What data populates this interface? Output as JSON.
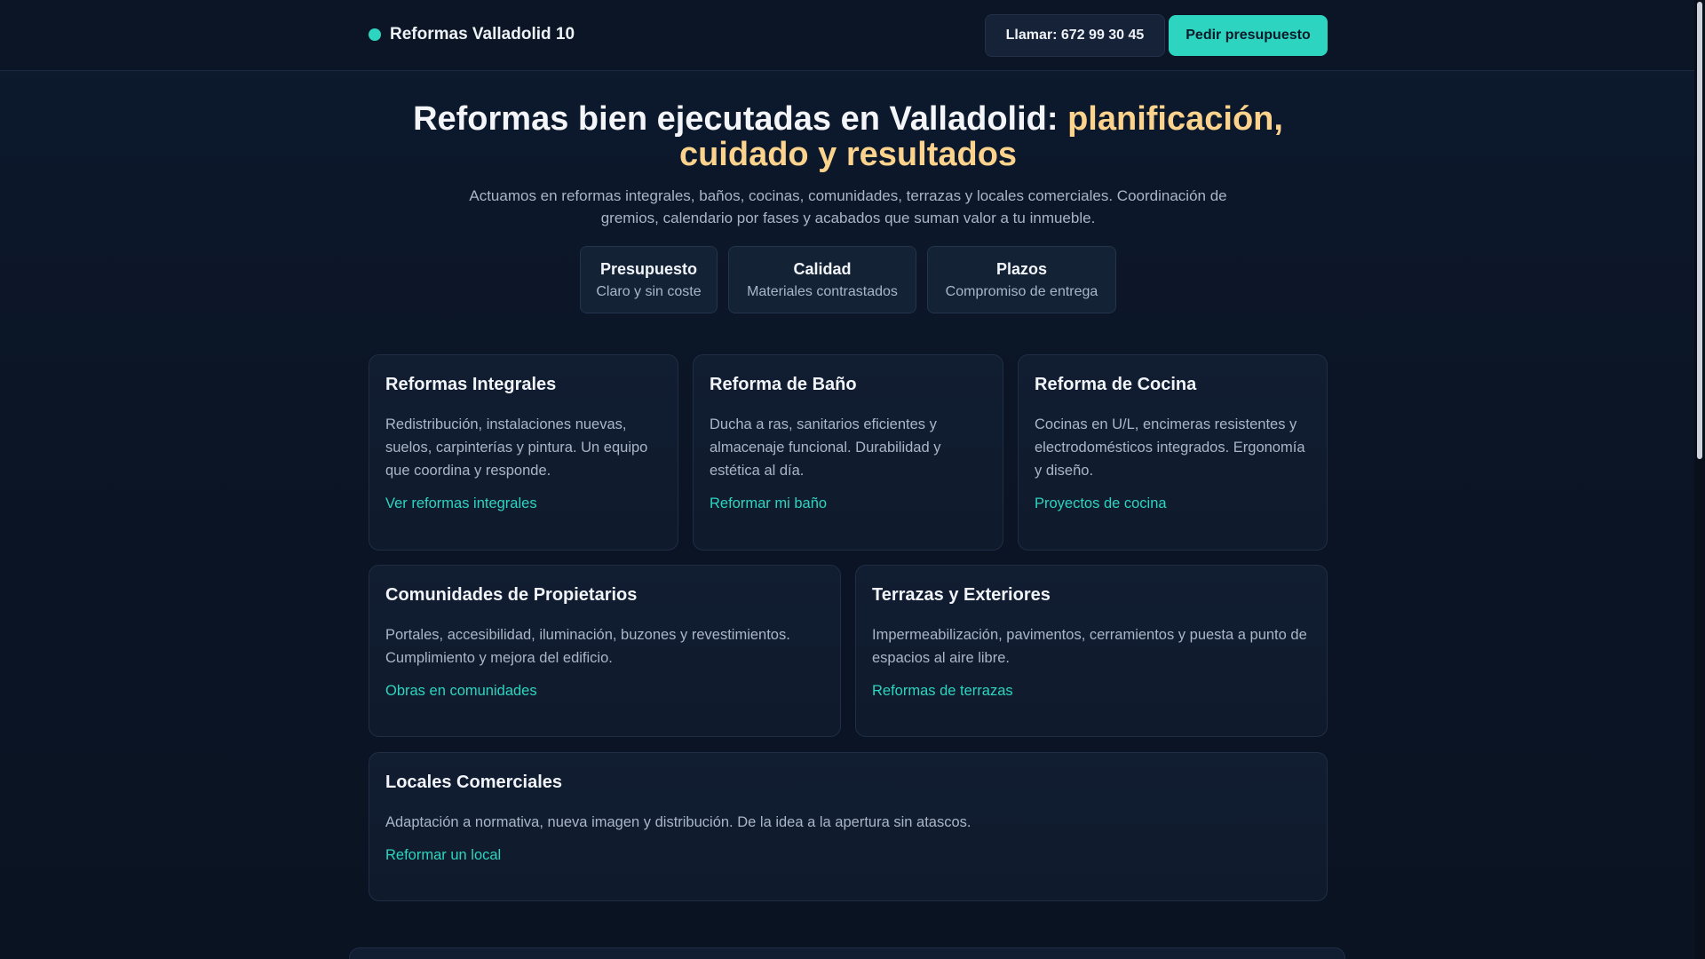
{
  "header": {
    "brand": "Reformas Valladolid 10",
    "call_label": "Llamar: 672 99 30 45",
    "quote_label": "Pedir presupuesto"
  },
  "hero": {
    "title_part1": "Reformas bien ejecutadas en Valladolid: ",
    "title_part2": "planificación, cuidado y resultados",
    "subtitle": "Actuamos en reformas integrales, baños, cocinas, comunidades, terrazas y locales comerciales. Coordinación de gremios, calendario por fases y acabados que suman valor a tu inmueble."
  },
  "features": [
    {
      "title": "Presupuesto",
      "text": "Claro y sin coste"
    },
    {
      "title": "Calidad",
      "text": "Materiales contrastados"
    },
    {
      "title": "Plazos",
      "text": "Compromiso de entrega"
    }
  ],
  "services": [
    {
      "title": "Reformas Integrales",
      "text": "Redistribución, instalaciones nuevas, suelos, carpinterías y pintura. Un equipo que coordina y responde.",
      "link": "Ver reformas integrales"
    },
    {
      "title": "Reforma de Baño",
      "text": "Ducha a ras, sanitarios eficientes y almacenaje funcional. Durabilidad y estética al día.",
      "link": "Reformar mi baño"
    },
    {
      "title": "Reforma de Cocina",
      "text": "Cocinas en U/L, encimeras resistentes y electrodomésticos integrados. Ergonomía y diseño.",
      "link": "Proyectos de cocina"
    },
    {
      "title": "Comunidades de Propietarios",
      "text": "Portales, accesibilidad, iluminación, buzones y revestimientos. Cumplimiento y mejora del edificio.",
      "link": "Obras en comunidades"
    },
    {
      "title": "Terrazas y Exteriores",
      "text": "Impermeabilización, pavimentos, cerramientos y puesta a punto de espacios al aire libre.",
      "link": "Reformas de terrazas"
    },
    {
      "title": "Locales Comerciales",
      "text": "Adaptación a normativa, nueva imagen y distribución. De la idea a la apertura sin atascos.",
      "link": "Reformar un local"
    }
  ],
  "colors": {
    "accent": "#2dd4bf",
    "highlight": "#fbd38d",
    "background": "#0b1424"
  }
}
